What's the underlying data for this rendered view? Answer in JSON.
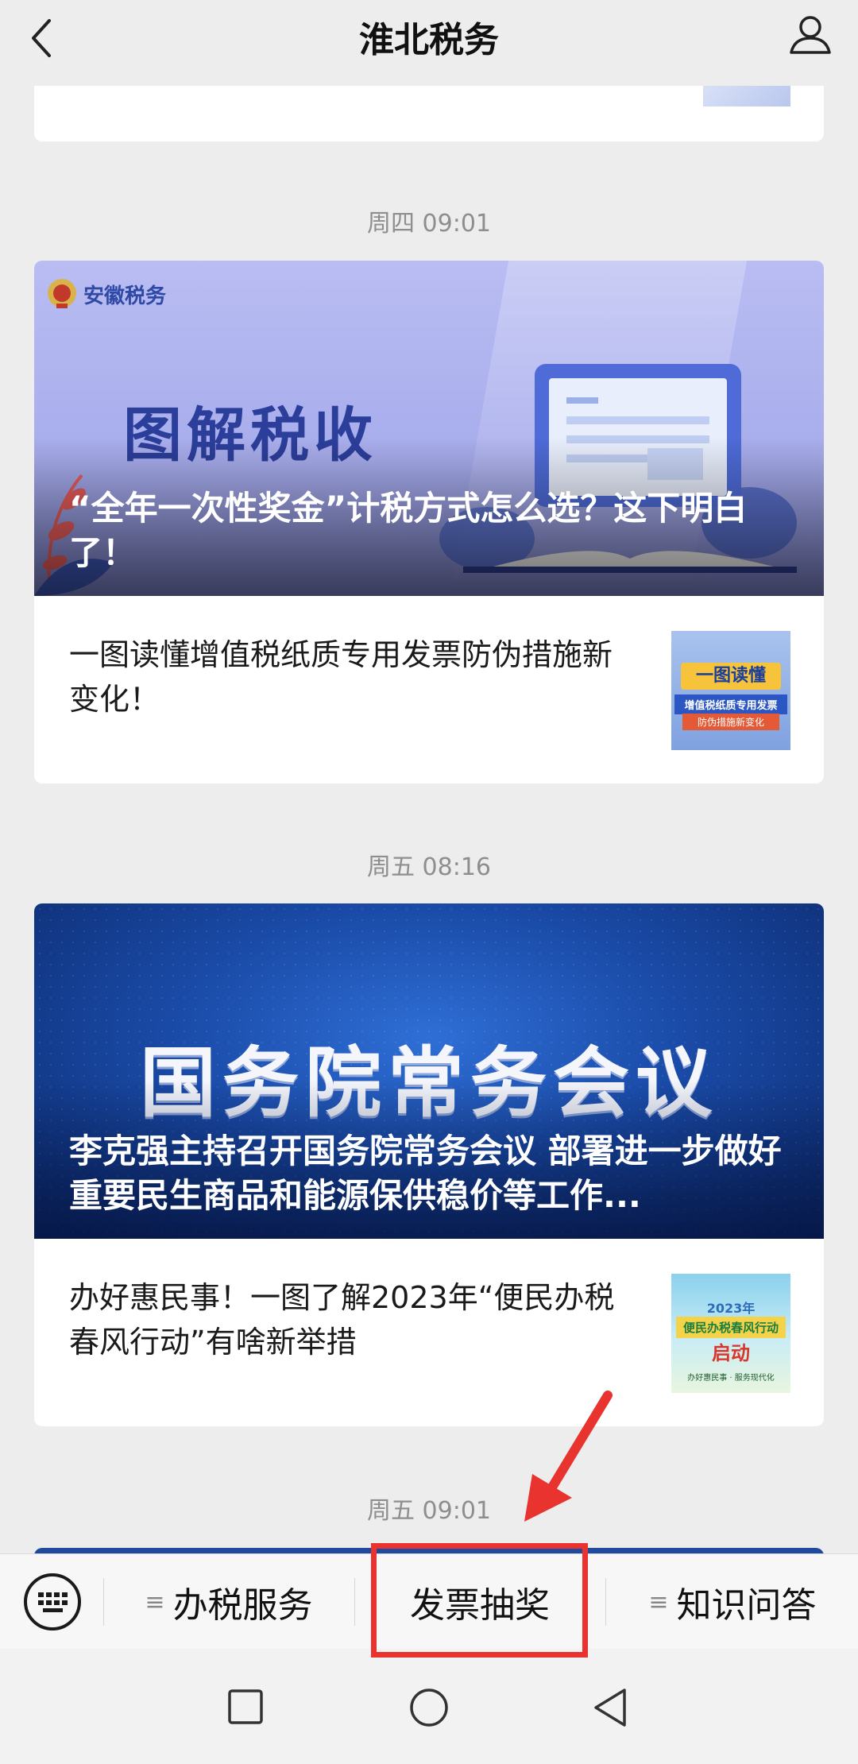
{
  "app": {
    "title": "淮北税务"
  },
  "feed": {
    "timestamps": [
      "周四 09:01",
      "周五 08:16",
      "周五 09:01"
    ],
    "group1": {
      "banner": {
        "brand": "安徽税务",
        "headline": "图解税收",
        "caption": "“全年一次性奖金”计税方式怎么选？这下明白了！"
      },
      "item": {
        "title": "一图读懂增值税纸质专用发票防伪措施新变化！",
        "thumb_line1": "一图读懂",
        "thumb_line2": "增值税纸质专用发票",
        "thumb_line3": "防伪措施新变化"
      }
    },
    "group2": {
      "banner": {
        "headline": "国务院常务会议",
        "caption": "李克强主持召开国务院常务会议 部署进一步做好重要民生商品和能源保供稳价等工作..."
      },
      "item": {
        "title": "办好惠民事！一图了解2023年“便民办税春风行动”有啥新举措",
        "thumb_year": "2023年",
        "thumb_line1": "便民办税春风行动",
        "thumb_line2": "启动",
        "thumb_line3": "办好惠民事 · 服务现代化"
      }
    }
  },
  "menu": {
    "items": [
      "办税服务",
      "发票抽奖",
      "知识问答"
    ]
  },
  "colors": {
    "highlight": "#e8332e",
    "background": "#ededed"
  }
}
